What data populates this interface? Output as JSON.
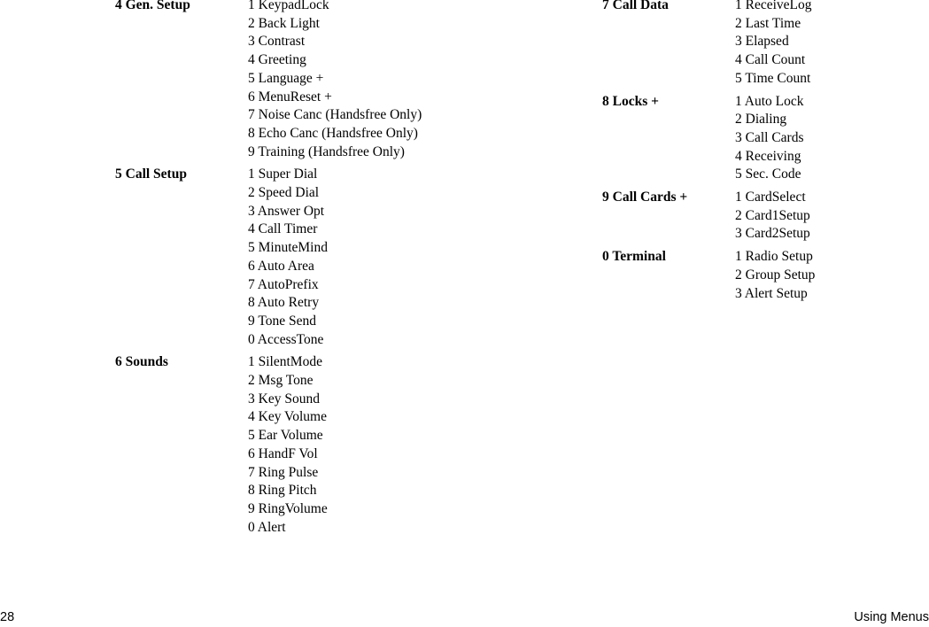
{
  "document": {
    "page_number": "28",
    "running_head": "Using Menus"
  },
  "menu_map": {
    "left_column": [
      {
        "title": "4 Gen. Setup",
        "items": [
          "1 KeypadLock",
          "2 Back Light",
          "3 Contrast",
          "4 Greeting",
          "5 Language +",
          "6 MenuReset +",
          "7 Noise Canc (Handsfree Only)",
          "8 Echo Canc (Handsfree Only)",
          "9 Training (Handsfree Only)"
        ]
      },
      {
        "title": "5 Call Setup",
        "items": [
          "1 Super Dial",
          "2 Speed Dial",
          "3 Answer Opt",
          "4 Call Timer",
          "5 MinuteMind",
          "6 Auto Area",
          "7 AutoPrefix",
          "8 Auto Retry",
          "9 Tone Send",
          "0 AccessTone"
        ]
      },
      {
        "title": "6 Sounds",
        "items": [
          "1 SilentMode",
          "2 Msg Tone",
          "3 Key Sound",
          "4 Key Volume",
          "5 Ear Volume",
          "6 HandF Vol",
          "7 Ring Pulse",
          "8 Ring Pitch",
          "9 RingVolume",
          "0 Alert"
        ]
      }
    ],
    "right_column": [
      {
        "title": "7 Call Data",
        "items": [
          "1 ReceiveLog",
          "2 Last Time",
          "3 Elapsed",
          "4 Call Count",
          "5 Time Count"
        ]
      },
      {
        "title": "8 Locks +",
        "items": [
          "1 Auto Lock",
          "2 Dialing",
          "3 Call Cards",
          "4 Receiving",
          "5 Sec. Code"
        ]
      },
      {
        "title": "9 Call Cards +",
        "items": [
          "1 CardSelect",
          "2 Card1Setup",
          "3 Card2Setup"
        ]
      },
      {
        "title": "0 Terminal",
        "items": [
          "1 Radio Setup",
          "2 Group Setup",
          "3 Alert Setup"
        ]
      }
    ]
  }
}
